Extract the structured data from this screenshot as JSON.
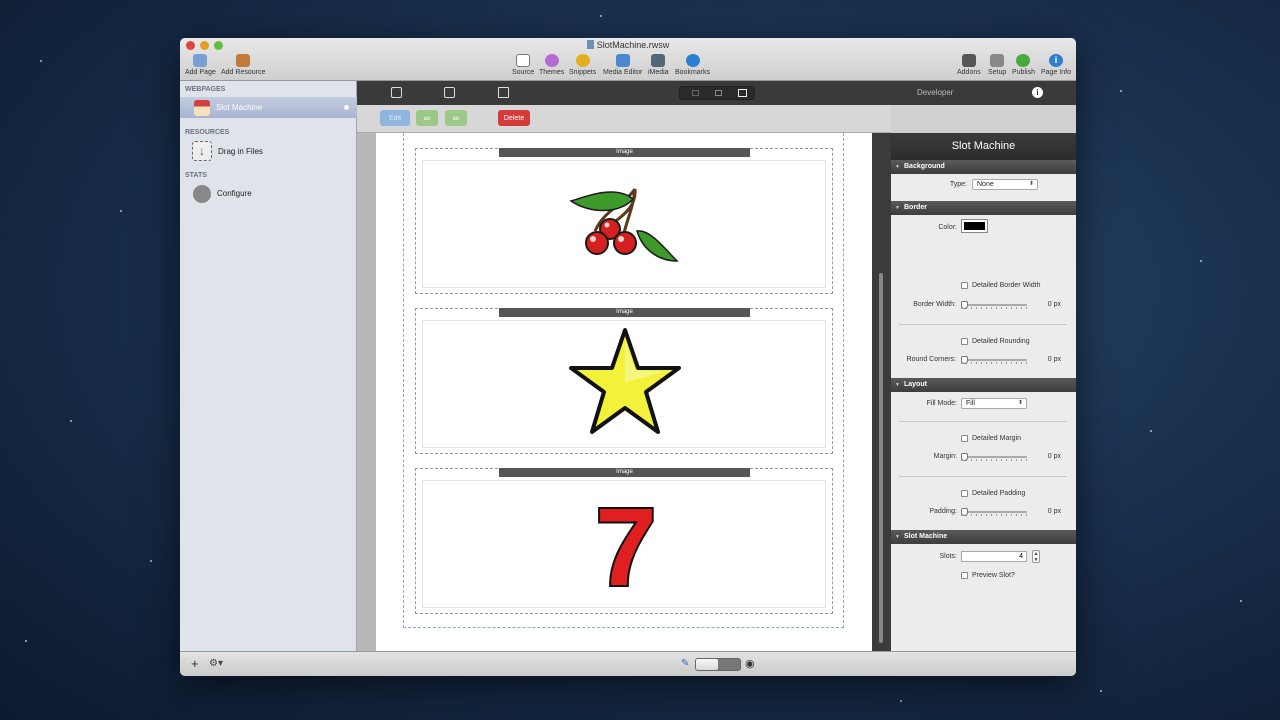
{
  "window": {
    "title": "SlotMachine.rwsw"
  },
  "toolbar": {
    "left": [
      {
        "label": "Add Page",
        "icon": "add-page-icon",
        "color": "#7aa0d0"
      },
      {
        "label": "Add Resource",
        "icon": "add-resource-icon",
        "color": "#c07a3a"
      }
    ],
    "center": [
      {
        "label": "Source",
        "icon": "source-icon",
        "color": "#777777"
      },
      {
        "label": "Themes",
        "icon": "themes-icon",
        "color": "#b56ad0"
      },
      {
        "label": "Snippets",
        "icon": "snippets-icon",
        "color": "#e0b020"
      },
      {
        "label": "Media Editor",
        "icon": "media-editor-icon",
        "color": "#4a88d0"
      },
      {
        "label": "iMedia",
        "icon": "imedia-icon",
        "color": "#556677"
      },
      {
        "label": "Bookmarks",
        "icon": "bookmarks-icon",
        "color": "#2d7fd0"
      }
    ],
    "right": [
      {
        "label": "Addons",
        "icon": "addons-icon",
        "color": "#555555"
      },
      {
        "label": "Setup",
        "icon": "setup-icon",
        "color": "#888888"
      },
      {
        "label": "Publish",
        "icon": "publish-icon",
        "color": "#4aa840"
      },
      {
        "label": "Page Info",
        "icon": "page-info-icon",
        "color": "#2d7fd0"
      }
    ]
  },
  "sidebar": {
    "webpages_header": "WEBPAGES",
    "page_item": "Slot Machine",
    "resources_header": "RESOURCES",
    "resources_item": "Drag in Files",
    "stats_header": "STATS",
    "stats_item": "Configure"
  },
  "editor": {
    "edit_button": "Edit",
    "delete_button": "Delete",
    "slots": [
      {
        "label": "Image",
        "symbol": "cherries"
      },
      {
        "label": "Image",
        "symbol": "star"
      },
      {
        "label": "Image",
        "symbol": "seven",
        "text": "7"
      }
    ]
  },
  "inspector": {
    "tab_developer": "Developer",
    "title": "Slot Machine",
    "background": {
      "header": "Background",
      "type_label": "Type:",
      "type_value": "None"
    },
    "border": {
      "header": "Border",
      "color_label": "Color:",
      "color_value": "#000000",
      "detailed_width": "Detailed Border Width",
      "width_label": "Border Width:",
      "width_value": "0 px",
      "detailed_rounding": "Detailed Rounding",
      "round_label": "Round Corners:",
      "round_value": "0 px"
    },
    "layout": {
      "header": "Layout",
      "fill_label": "Fill Mode:",
      "fill_value": "Fill",
      "detailed_margin": "Detailed Margin",
      "margin_label": "Margin:",
      "margin_value": "0 px",
      "detailed_padding": "Detailed Padding",
      "padding_label": "Padding:",
      "padding_value": "0 px"
    },
    "slot_machine": {
      "header": "Slot Machine",
      "slots_label": "Slots:",
      "slots_value": "4",
      "preview_label": "Preview Slot?"
    }
  }
}
